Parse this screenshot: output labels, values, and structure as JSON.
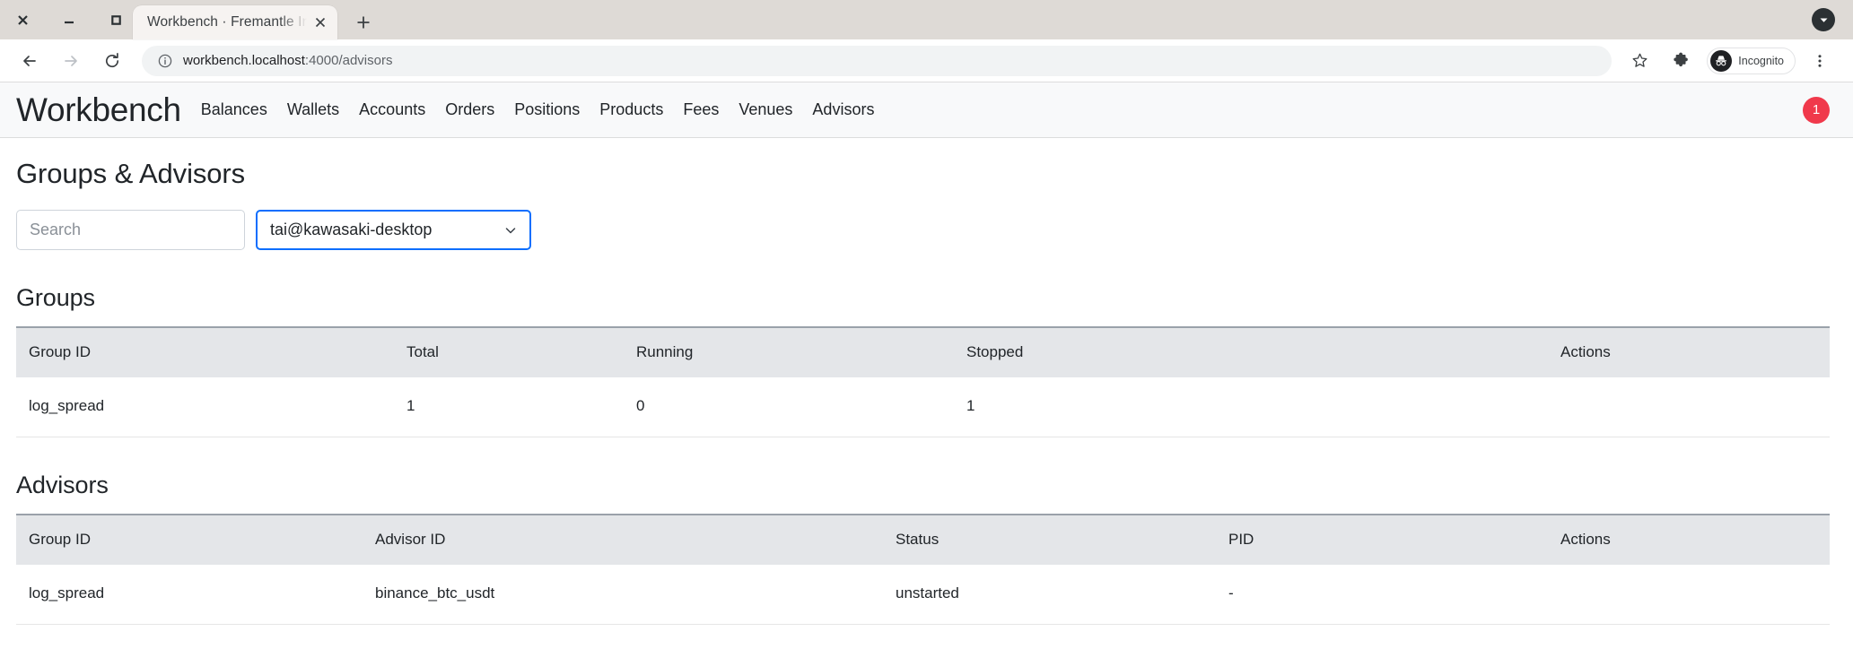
{
  "window": {
    "controls": [
      "close",
      "minimize",
      "maximize"
    ],
    "tab_search_icon": "chevron-down-circle-icon"
  },
  "browser": {
    "tab": {
      "title": "Workbench · Fremantle Ind",
      "close_icon": "close-icon"
    },
    "new_tab_label": "+",
    "toolbar": {
      "back_icon": "arrow-left-icon",
      "forward_icon": "arrow-right-icon",
      "reload_icon": "reload-icon",
      "info_icon": "info-circle-icon",
      "url_host": "workbench.localhost",
      "url_path": ":4000/advisors",
      "bookmark_icon": "star-icon",
      "extensions_icon": "puzzle-piece-icon",
      "incognito_label": "Incognito",
      "incognito_icon": "incognito-hat-icon",
      "menu_icon": "three-dots-vertical-icon"
    }
  },
  "app": {
    "brand": "Workbench",
    "nav": [
      {
        "label": "Balances"
      },
      {
        "label": "Wallets"
      },
      {
        "label": "Accounts"
      },
      {
        "label": "Orders"
      },
      {
        "label": "Positions"
      },
      {
        "label": "Products"
      },
      {
        "label": "Fees"
      },
      {
        "label": "Venues"
      },
      {
        "label": "Advisors"
      }
    ],
    "badge": {
      "count": "1",
      "color": "#f0394b"
    }
  },
  "page": {
    "title": "Groups & Advisors",
    "search": {
      "value": "",
      "placeholder": "Search"
    },
    "host_select": {
      "value": "tai@kawasaki-desktop",
      "chevron_icon": "chevron-down-icon",
      "focus_color": "#0d6efd"
    },
    "groups": {
      "heading": "Groups",
      "columns": [
        "Group ID",
        "Total",
        "Running",
        "Stopped",
        "Actions"
      ],
      "rows": [
        {
          "group_id": "log_spread",
          "total": "1",
          "running": "0",
          "stopped": "1",
          "actions": ""
        }
      ]
    },
    "advisors": {
      "heading": "Advisors",
      "columns": [
        "Group ID",
        "Advisor ID",
        "Status",
        "PID",
        "Actions"
      ],
      "rows": [
        {
          "group_id": "log_spread",
          "advisor_id": "binance_btc_usdt",
          "status": "unstarted",
          "pid": "-",
          "actions": ""
        }
      ]
    }
  }
}
